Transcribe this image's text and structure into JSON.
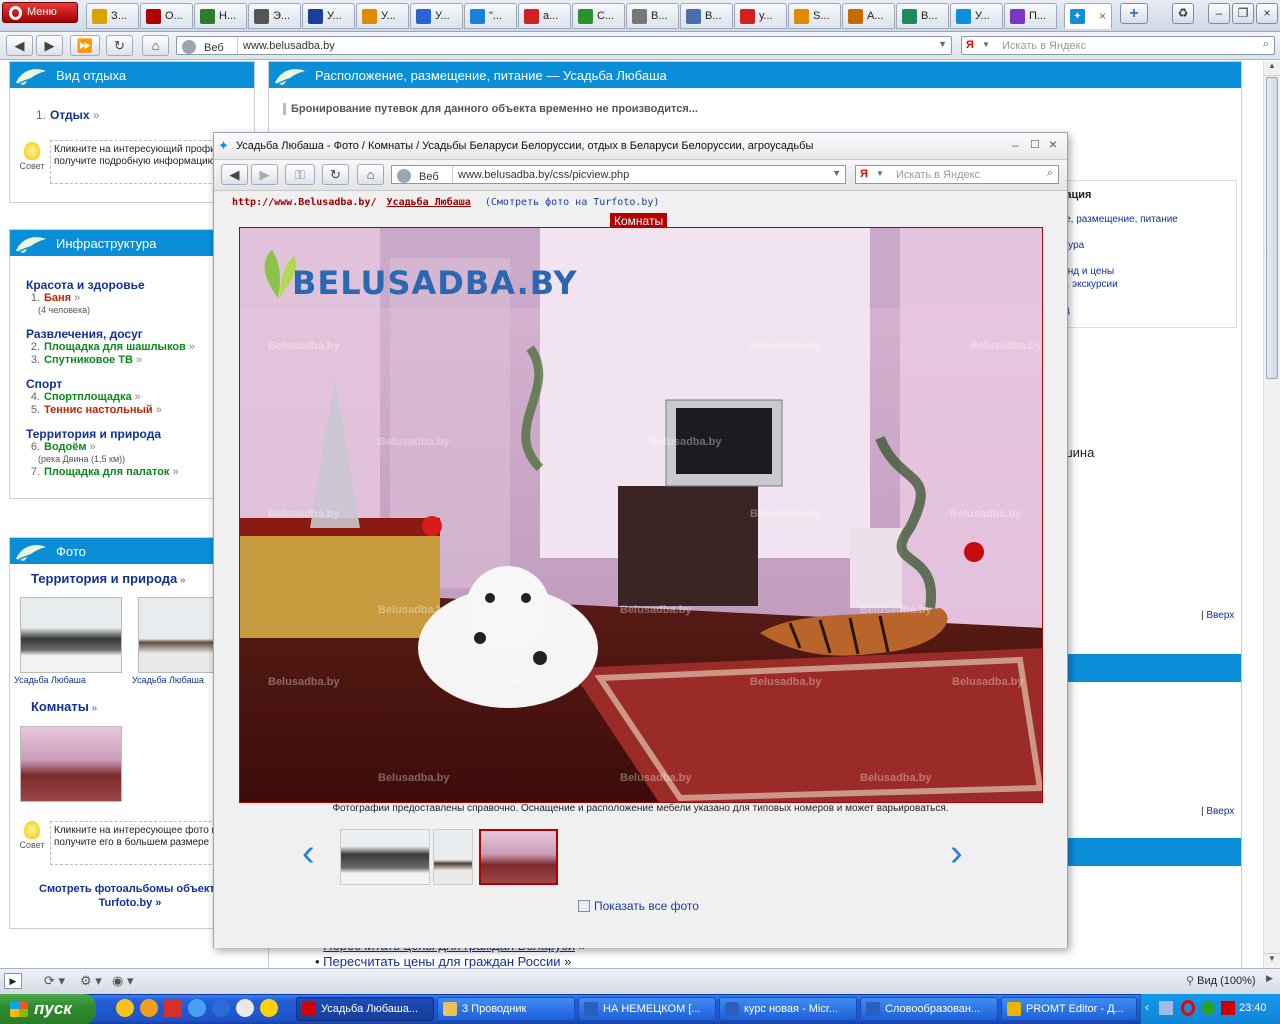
{
  "browser": {
    "menu_label": "Меню",
    "tabs": [
      {
        "label": "З...",
        "color": "#d8a400"
      },
      {
        "label": "О...",
        "color": "#b00000"
      },
      {
        "label": "Н...",
        "color": "#2d7d2d"
      },
      {
        "label": "Э...",
        "color": "#555555"
      },
      {
        "label": "У...",
        "color": "#1a3f9a"
      },
      {
        "label": "У...",
        "color": "#e08a00"
      },
      {
        "label": "У...",
        "color": "#2b62d6"
      },
      {
        "label": "\"...",
        "color": "#1d7fd5"
      },
      {
        "label": "а...",
        "color": "#d02020"
      },
      {
        "label": "С...",
        "color": "#2d8f2d"
      },
      {
        "label": "В...",
        "color": "#777777"
      },
      {
        "label": "В...",
        "color": "#4a6ea8"
      },
      {
        "label": "у...",
        "color": "#d02020"
      },
      {
        "label": "S...",
        "color": "#e38a00"
      },
      {
        "label": "А...",
        "color": "#c46b00"
      },
      {
        "label": "В...",
        "color": "#1f8a5d"
      },
      {
        "label": "У...",
        "color": "#0d8fd9"
      },
      {
        "label": "П...",
        "color": "#7a37c6"
      }
    ],
    "active_tab_label": "",
    "add_tab_label": "+",
    "address": "www.belusadba.by",
    "address_scheme_label": "Веб",
    "search_placeholder": "Искать в Яндекс",
    "search_engine_glyph": "Я"
  },
  "page": {
    "left_panels": {
      "leisure": {
        "title": "Вид отдыха",
        "items": [
          {
            "num": "1.",
            "label": "Отдых"
          }
        ],
        "tip_text": "Кликните на интересующий профиль и получите подробную информацию",
        "tip_label": "Совет"
      },
      "infra": {
        "title": "Инфраструктура",
        "groups": [
          {
            "title": "Красота и здоровье",
            "items": [
              {
                "num": "1.",
                "label": "Баня",
                "color": "red",
                "note": "(4 человека)"
              }
            ]
          },
          {
            "title": "Развлечения, досуг",
            "items": [
              {
                "num": "2.",
                "label": "Площадка для шашлыков",
                "color": "green"
              },
              {
                "num": "3.",
                "label": "Спутниковое ТВ",
                "color": "green"
              }
            ]
          },
          {
            "title": "Спорт",
            "items": [
              {
                "num": "4.",
                "label": "Спортплощадка",
                "color": "green"
              },
              {
                "num": "5.",
                "label": "Теннис настольный",
                "color": "red"
              }
            ]
          },
          {
            "title": "Территория и природа",
            "items": [
              {
                "num": "6.",
                "label": "Водоём",
                "color": "green",
                "note": "(река Двина (1,5 км))"
              },
              {
                "num": "7.",
                "label": "Площадка для палаток",
                "color": "green"
              }
            ]
          }
        ]
      },
      "photo": {
        "title": "Фото",
        "section1": "Территория и природа",
        "thumb_captions": [
          "Усадьба Любаша",
          "Усадьба Любаша"
        ],
        "section2": "Комнаты",
        "tip_text": "Кликните на интересующее фото и получите его в большем размере",
        "tip_label": "Совет",
        "albums_link": "Смотреть фотоальбомы объекта",
        "albums_link2": "Turfoto.by"
      }
    },
    "main": {
      "title": "Расположение, размещение, питание — Усадьба Любаша",
      "notice": "Бронирование путевок для данного объекта временно не производится...",
      "nav_title": "игация",
      "nav_items": [
        "ние, размещение, питание",
        "а",
        "уктура",
        "ей",
        "фонд и цены",
        "суг, экскурсии",
        "",
        "езд"
      ],
      "partial_text": "ашина",
      "top_link_1": "Вверх",
      "top_link_2": "Вверх",
      "bottom_links": [
        "Пересчитать цены для граждан Беларуси",
        "Пересчитать цены для граждан России"
      ]
    }
  },
  "popup": {
    "title": "Усадьба Любаша - Фото / Комнаты / Усадьбы Беларуси Белоруссии, отдых в Беларуси Белоруссии, агроусадьбы",
    "address": "www.belusadba.by/css/picview.php",
    "address_scheme_label": "Веб",
    "search_placeholder": "Искать в Яндекс",
    "crumb_site": "http://www.Belusadba.by/",
    "crumb_estate": "Усадьба Любаша",
    "crumb_turfoto": "(Смотреть фото на Turfoto.by)",
    "category_label": "Комнаты",
    "logo_text": "BELUSADBA.BY",
    "watermark": "Belusadba.by",
    "disclaimer": "Фотографии предоставлены справочно. Оснащение и расположение мебели указано для типовых номеров и может варьироваться.",
    "show_all": "Показать все фото"
  },
  "status": {
    "zoom": "Вид (100%)"
  },
  "taskbar": {
    "start": "пуск",
    "tasks": [
      {
        "label": "Усадьба Любаша...",
        "color": "#d40000",
        "active": true
      },
      {
        "label": "3 Проводник",
        "color": "#e8c35a",
        "active": false
      },
      {
        "label": "НА НЕМЕЦКОМ [...",
        "color": "#2b5fbf",
        "active": false
      },
      {
        "label": "курс новая - Micr...",
        "color": "#2b5fbf",
        "active": false
      },
      {
        "label": "Словообразован...",
        "color": "#2b5fbf",
        "active": false
      },
      {
        "label": "PROMT Editor - Д...",
        "color": "#f0b400",
        "active": false
      }
    ],
    "clock": "23:40"
  }
}
